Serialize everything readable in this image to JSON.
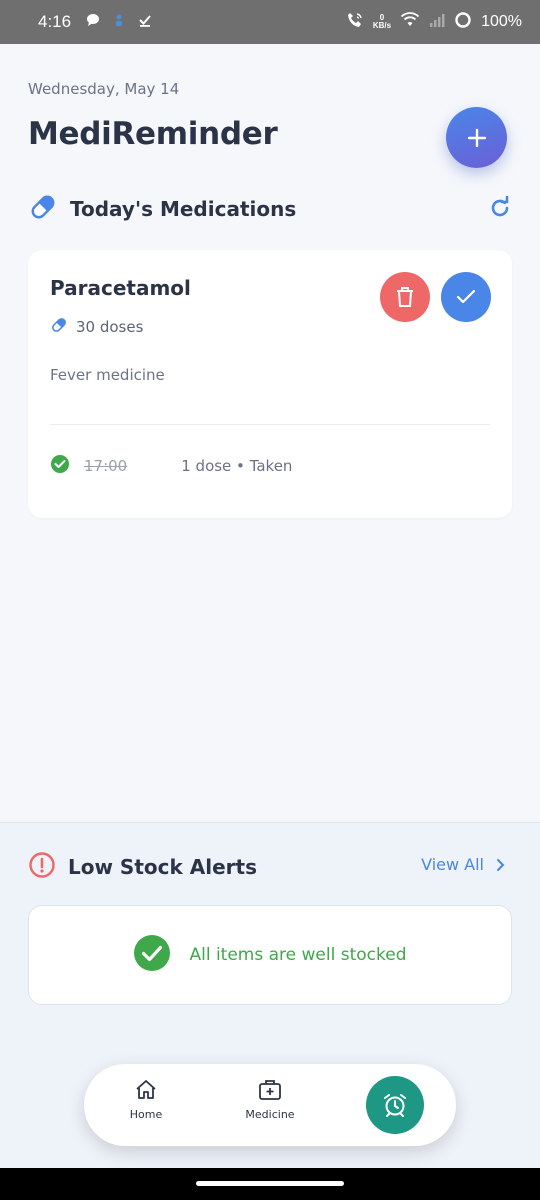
{
  "status_bar": {
    "time": "4:16",
    "net_speed_value": "0",
    "net_speed_unit": "KB/s",
    "battery": "100%"
  },
  "header": {
    "date": "Wednesday, May 14",
    "title": "MediReminder",
    "add_icon": "plus-icon"
  },
  "todays_section": {
    "title": "Today's Medications",
    "icon": "pill-icon",
    "refresh_icon": "refresh-icon"
  },
  "medications": [
    {
      "name": "Paracetamol",
      "doses": "30 doses",
      "description": "Fever medicine",
      "schedule": {
        "time": "17:00",
        "status": "1 dose • Taken",
        "taken": true
      }
    }
  ],
  "low_stock": {
    "title": "Low Stock Alerts",
    "view_all": "View All",
    "message": "All items are well stocked"
  },
  "nav": {
    "home": "Home",
    "medicine": "Medicine",
    "alarm_icon": "alarm-clock-icon"
  },
  "colors": {
    "accent_blue": "#4a86e8",
    "danger_red": "#ef6868",
    "success_green": "#3ea84a",
    "teal": "#1e9785"
  }
}
